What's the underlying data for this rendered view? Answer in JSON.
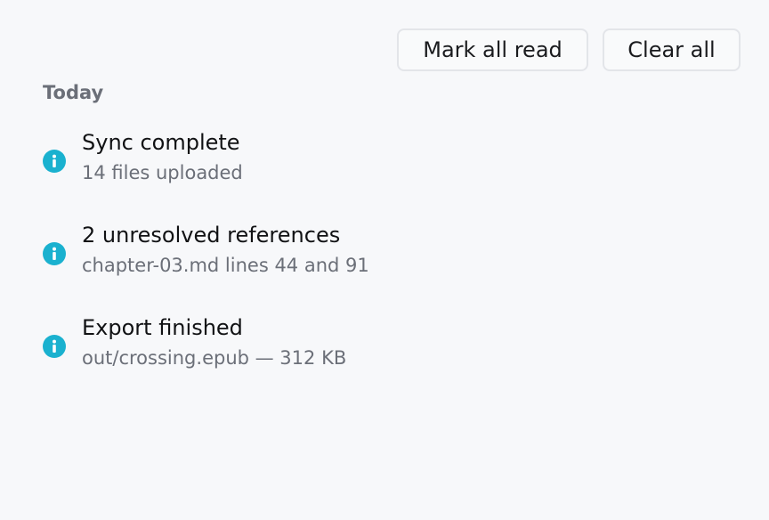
{
  "toolbar": {
    "mark_all_read_label": "Mark all read",
    "clear_all_label": "Clear all"
  },
  "sections": [
    {
      "heading": "Today",
      "notifications": [
        {
          "icon": "info-icon",
          "title": "Sync complete",
          "detail": "14 files uploaded"
        },
        {
          "icon": "info-icon",
          "title": "2 unresolved references",
          "detail": "chapter-03.md lines 44 and 91"
        },
        {
          "icon": "info-icon",
          "title": "Export finished",
          "detail": "out/crossing.epub — 312 KB"
        }
      ]
    }
  ],
  "colors": {
    "background": "#f7f8fa",
    "info_accent": "#1ab1cf",
    "muted_text": "#6b6f78",
    "button_border": "#e3e5e9"
  }
}
